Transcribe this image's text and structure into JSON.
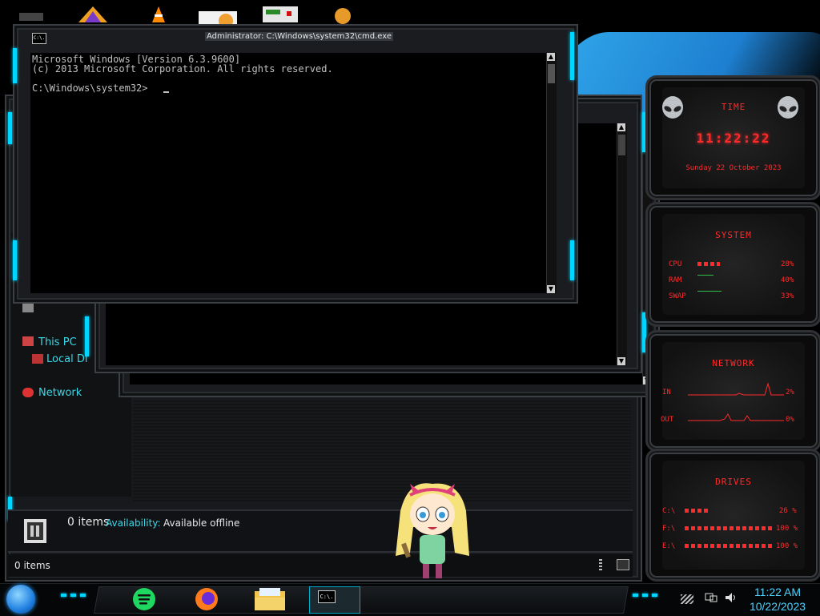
{
  "explorer": {
    "nav_this_pc": "This PC",
    "nav_local_disk": "Local Di",
    "nav_network": "Network",
    "details_items": "0 items",
    "details_availability_label": "Availability:",
    "details_availability_value": "Available offline",
    "status_items": "0 items"
  },
  "cmd": {
    "title": "Administrator: C:\\Windows\\system32\\cmd.exe",
    "icon_label": "C:\\.",
    "line1": "Microsoft Windows [Version 6.3.9600]",
    "line2": "(c) 2013 Microsoft Corporation. All rights reserved.",
    "prompt": "C:\\Windows\\system32>"
  },
  "gadgets": {
    "time": {
      "title": "TIME",
      "clock": "11:22:22",
      "date": "Sunday 22 October 2023"
    },
    "system": {
      "title": "SYSTEM",
      "rows": [
        {
          "label": "CPU",
          "value": "28%",
          "level": 0.28
        },
        {
          "label": "RAM",
          "value": "40%",
          "level": 0.4
        },
        {
          "label": "SWAP",
          "value": "33%",
          "level": 0.33
        }
      ]
    },
    "network": {
      "title": "NETWORK",
      "rows": [
        {
          "label": "IN",
          "value": "2%"
        },
        {
          "label": "OUT",
          "value": "0%"
        }
      ]
    },
    "drives": {
      "title": "DRIVES",
      "rows": [
        {
          "label": "C:\\",
          "value": "26 %",
          "level": 0.26
        },
        {
          "label": "F:\\",
          "value": "100 %",
          "level": 1.0
        },
        {
          "label": "E:\\",
          "value": "100 %",
          "level": 1.0
        }
      ]
    }
  },
  "taskbar": {
    "time": "11:22 AM",
    "date": "10/22/2023",
    "cmd_button_label": "C:\\."
  },
  "colors": {
    "accent_cyan": "#00d6ff",
    "gadget_red": "#ff2a2a",
    "wallpaper_blue": "#1e7fd0"
  }
}
